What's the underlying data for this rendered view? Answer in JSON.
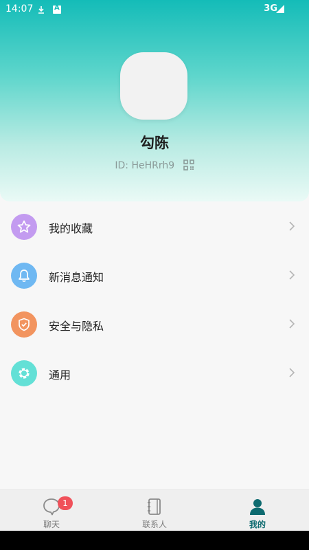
{
  "status_bar": {
    "time": "14:07",
    "network": "3G"
  },
  "profile": {
    "name": "勾陈",
    "id_text": "ID: HeHRrh9"
  },
  "menu": {
    "items": [
      {
        "label": "我的收藏",
        "icon": "star-icon",
        "color": "#c39bf0"
      },
      {
        "label": "新消息通知",
        "icon": "bell-icon",
        "color": "#6fb8f2"
      },
      {
        "label": "安全与隐私",
        "icon": "shield-icon",
        "color": "#f2945f"
      },
      {
        "label": "通用",
        "icon": "settings-icon",
        "color": "#63e0d6"
      }
    ]
  },
  "tabbar": {
    "tabs": [
      {
        "label": "聊天",
        "badge": "1",
        "icon": "chat-bubble-icon"
      },
      {
        "label": "联系人",
        "icon": "address-book-icon"
      },
      {
        "label": "我的",
        "icon": "person-icon",
        "active": true
      }
    ]
  },
  "colors": {
    "header_top": "#14bcb8",
    "accent": "#0e6b70",
    "badge": "#f0515a"
  }
}
